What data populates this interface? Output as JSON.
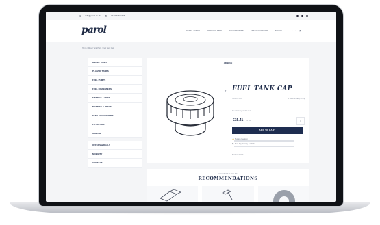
{
  "topbar": {
    "email": "info@parol.co.uk",
    "phone": "0113 279 0777"
  },
  "header": {
    "logo": "parol",
    "nav": [
      "DIESEL TANKS",
      "DIESEL PUMPS",
      "ACCESSORIES",
      "SPECIAL OFFERS",
      "ABOUT"
    ]
  },
  "breadcrumb": "Home / Diesel Tank Parts / Fuel Tank Cap",
  "sidebar": {
    "items": [
      "DIESEL TANKS",
      "PLASTIC TANKS",
      "FUEL PUMPS",
      "FUEL DISPENSERS",
      "FITTINGS & HOSE",
      "NOZZLES & REELS",
      "TANK ACCESSORIES",
      "FILTRATION",
      "ADBLUE",
      "OFFERS & DEALS",
      "MOBILITY",
      "CONTACT"
    ]
  },
  "product": {
    "section_head": "ADBLUE",
    "title": "FUEL TANK CAP",
    "sku": "SKU: FTC-01",
    "stock": "In stock & ready to ship",
    "delivery": "Free delivery on this item",
    "price": "£15.41",
    "price_vat": "inc VAT",
    "qty": "1",
    "add_label": "ADD TO CART",
    "info1": "Secure checkout",
    "info2": "Next day delivery available",
    "info3": "Product details"
  },
  "recommendations": {
    "subtitle": "YOU MIGHT ALSO LIKE",
    "title": "RECOMMENDATIONS"
  },
  "colors": {
    "navy": "#1e2d50",
    "bezel": "#101216",
    "page_bg": "#f4f5f7"
  }
}
